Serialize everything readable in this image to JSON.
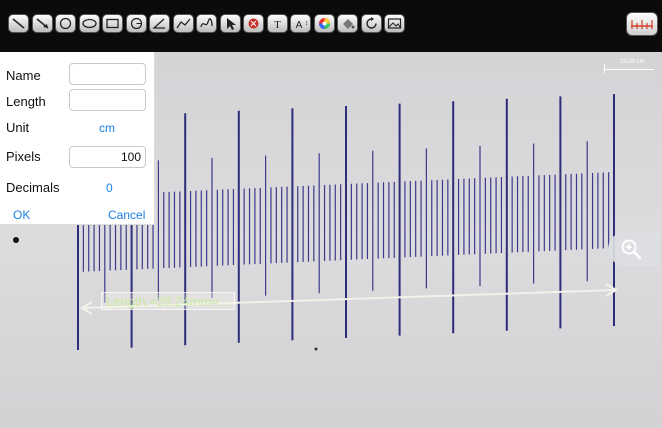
{
  "toolbar": {
    "tools": [
      {
        "name": "line-tool-icon"
      },
      {
        "name": "arrow-line-tool-icon"
      },
      {
        "name": "circle-tool-icon"
      },
      {
        "name": "ellipse-tool-icon"
      },
      {
        "name": "rectangle-tool-icon"
      },
      {
        "name": "arc-tool-icon"
      },
      {
        "name": "angle-tool-icon"
      },
      {
        "name": "polyline-tool-icon"
      },
      {
        "name": "freehand-tool-icon"
      },
      {
        "name": "select-arrow-icon"
      },
      {
        "name": "delete-icon"
      },
      {
        "name": "text-tool-icon"
      },
      {
        "name": "text-size-icon"
      },
      {
        "name": "color-wheel-icon"
      },
      {
        "name": "fill-tool-icon"
      },
      {
        "name": "rotate-icon"
      },
      {
        "name": "image-icon"
      }
    ],
    "ruler_button": "ruler-icon"
  },
  "calibration_panel": {
    "name_label": "Name",
    "name_value": "",
    "length_label": "Length",
    "length_value": "",
    "unit_label": "Unit",
    "unit_value": "cm",
    "pixels_label": "Pixels",
    "pixels_value": "100",
    "decimals_label": "Decimals",
    "decimals_value": "0",
    "ok_label": "OK",
    "cancel_label": "Cancel"
  },
  "scale_bar": {
    "text": "10.00 cm"
  },
  "measurement": {
    "label": "Length:=28.24mm=..."
  },
  "colors": {
    "toolbar_bg": "#0b0b0b",
    "accent": "#1b7fe3",
    "ruler_icon": "#d4402a",
    "scale_marks": "#3b3a8c"
  }
}
